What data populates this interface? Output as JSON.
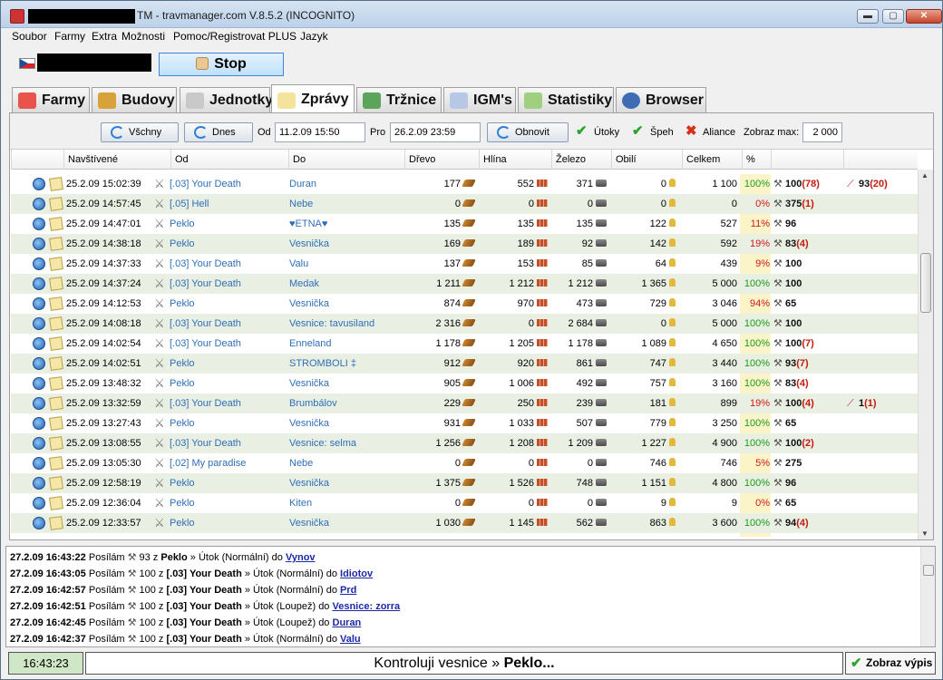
{
  "window": {
    "title": "TM - travmanager.com V.8.5.2 (INCOGNITO)",
    "buttons": {
      "minimize": "▬",
      "maximize": "▢",
      "close": "✕"
    }
  },
  "menu": [
    "Soubor",
    "Farmy",
    "Extra",
    "Možnosti",
    "Pomoc/Registrovat PLUS",
    "Jazyk"
  ],
  "toolbar": {
    "stop_label": "Stop"
  },
  "tabs": [
    {
      "label": "Farmy",
      "active": false
    },
    {
      "label": "Budovy",
      "active": false
    },
    {
      "label": "Jednotky",
      "active": false
    },
    {
      "label": "Zprávy",
      "active": true
    },
    {
      "label": "Tržnice",
      "active": false
    },
    {
      "label": "IGM's",
      "active": false
    },
    {
      "label": "Statistiky",
      "active": false
    },
    {
      "label": "Browser",
      "active": false
    }
  ],
  "filter": {
    "all_label": "Všchny",
    "today_label": "Dnes",
    "from_label": "Od",
    "from_value": "11.2.09 15:50",
    "to_label": "Pro",
    "to_value": "26.2.09 23:59",
    "refresh_label": "Obnovit",
    "attacks_label": "Útoky",
    "spy_label": "Špeh",
    "alliance_label": "Aliance",
    "show_max_label": "Zobraz max:",
    "show_max_value": "2 000"
  },
  "columns": [
    "Navštívené",
    "Od",
    "Do",
    "Dřevo",
    "Hlína",
    "Železo",
    "Obilí",
    "Celkem",
    "%"
  ],
  "reports": [
    {
      "time": "25.2.09 15:02:39",
      "from": "[.03] Your Death",
      "to": "Duran",
      "wood": "177",
      "clay": "552",
      "iron": "371",
      "crop": "0",
      "total": "1 100",
      "pct": "100%",
      "pct_color": "green",
      "troops": "100",
      "troops_lost": "(78)",
      "def": "93",
      "def_lost": "(20)"
    },
    {
      "time": "25.2.09 14:57:45",
      "from": "[.05] Hell",
      "to": "Nebe",
      "wood": "0",
      "clay": "0",
      "iron": "0",
      "crop": "0",
      "total": "0",
      "pct": "0%",
      "pct_color": "red",
      "troops": "375",
      "troops_lost": "(1)",
      "def": "",
      "def_lost": ""
    },
    {
      "time": "25.2.09 14:47:01",
      "from": "Peklo",
      "to": "♥ETNA♥",
      "wood": "135",
      "clay": "135",
      "iron": "135",
      "crop": "122",
      "total": "527",
      "pct": "11%",
      "pct_color": "red",
      "troops": "96",
      "troops_lost": "",
      "def": "",
      "def_lost": ""
    },
    {
      "time": "25.2.09 14:38:18",
      "from": "Peklo",
      "to": "Vesnička",
      "wood": "169",
      "clay": "189",
      "iron": "92",
      "crop": "142",
      "total": "592",
      "pct": "19%",
      "pct_color": "red",
      "troops": "83",
      "troops_lost": "(4)",
      "def": "",
      "def_lost": ""
    },
    {
      "time": "25.2.09 14:37:33",
      "from": "[.03] Your Death",
      "to": "Valu",
      "wood": "137",
      "clay": "153",
      "iron": "85",
      "crop": "64",
      "total": "439",
      "pct": "9%",
      "pct_color": "red",
      "troops": "100",
      "troops_lost": "",
      "def": "",
      "def_lost": ""
    },
    {
      "time": "25.2.09 14:37:24",
      "from": "[.03] Your Death",
      "to": "Medak",
      "wood": "1 211",
      "clay": "1 212",
      "iron": "1 212",
      "crop": "1 365",
      "total": "5 000",
      "pct": "100%",
      "pct_color": "green",
      "troops": "100",
      "troops_lost": "",
      "def": "",
      "def_lost": ""
    },
    {
      "time": "25.2.09 14:12:53",
      "from": "Peklo",
      "to": "Vesnička",
      "wood": "874",
      "clay": "970",
      "iron": "473",
      "crop": "729",
      "total": "3 046",
      "pct": "94%",
      "pct_color": "red",
      "troops": "65",
      "troops_lost": "",
      "def": "",
      "def_lost": ""
    },
    {
      "time": "25.2.09 14:08:18",
      "from": "[.03] Your Death",
      "to": "Vesnice: tavusiland",
      "wood": "2 316",
      "clay": "0",
      "iron": "2 684",
      "crop": "0",
      "total": "5 000",
      "pct": "100%",
      "pct_color": "green",
      "troops": "100",
      "troops_lost": "",
      "def": "",
      "def_lost": ""
    },
    {
      "time": "25.2.09 14:02:54",
      "from": "[.03] Your Death",
      "to": "Enneland",
      "wood": "1 178",
      "clay": "1 205",
      "iron": "1 178",
      "crop": "1 089",
      "total": "4 650",
      "pct": "100%",
      "pct_color": "green",
      "troops": "100",
      "troops_lost": "(7)",
      "def": "",
      "def_lost": ""
    },
    {
      "time": "25.2.09 14:02:51",
      "from": "Peklo",
      "to": "STROMBOLI ‡",
      "wood": "912",
      "clay": "920",
      "iron": "861",
      "crop": "747",
      "total": "3 440",
      "pct": "100%",
      "pct_color": "green",
      "troops": "93",
      "troops_lost": "(7)",
      "def": "",
      "def_lost": ""
    },
    {
      "time": "25.2.09 13:48:32",
      "from": "Peklo",
      "to": "Vesnička",
      "wood": "905",
      "clay": "1 006",
      "iron": "492",
      "crop": "757",
      "total": "3 160",
      "pct": "100%",
      "pct_color": "green",
      "troops": "83",
      "troops_lost": "(4)",
      "def": "",
      "def_lost": ""
    },
    {
      "time": "25.2.09 13:32:59",
      "from": "[.03] Your Death",
      "to": "Brumbálov",
      "wood": "229",
      "clay": "250",
      "iron": "239",
      "crop": "181",
      "total": "899",
      "pct": "19%",
      "pct_color": "red",
      "troops": "100",
      "troops_lost": "(4)",
      "def": "1",
      "def_lost": "(1)"
    },
    {
      "time": "25.2.09 13:27:43",
      "from": "Peklo",
      "to": "Vesnička",
      "wood": "931",
      "clay": "1 033",
      "iron": "507",
      "crop": "779",
      "total": "3 250",
      "pct": "100%",
      "pct_color": "green",
      "troops": "65",
      "troops_lost": "",
      "def": "",
      "def_lost": ""
    },
    {
      "time": "25.2.09 13:08:55",
      "from": "[.03] Your Death",
      "to": "Vesnice: selma",
      "wood": "1 256",
      "clay": "1 208",
      "iron": "1 209",
      "crop": "1 227",
      "total": "4 900",
      "pct": "100%",
      "pct_color": "green",
      "troops": "100",
      "troops_lost": "(2)",
      "def": "",
      "def_lost": ""
    },
    {
      "time": "25.2.09 13:05:30",
      "from": "[.02] My paradise",
      "to": "Nebe",
      "wood": "0",
      "clay": "0",
      "iron": "0",
      "crop": "746",
      "total": "746",
      "pct": "5%",
      "pct_color": "red",
      "troops": "275",
      "troops_lost": "",
      "def": "",
      "def_lost": ""
    },
    {
      "time": "25.2.09 12:58:19",
      "from": "Peklo",
      "to": "Vesnička",
      "wood": "1 375",
      "clay": "1 526",
      "iron": "748",
      "crop": "1 151",
      "total": "4 800",
      "pct": "100%",
      "pct_color": "green",
      "troops": "96",
      "troops_lost": "",
      "def": "",
      "def_lost": ""
    },
    {
      "time": "25.2.09 12:36:04",
      "from": "Peklo",
      "to": "Kiten",
      "wood": "0",
      "clay": "0",
      "iron": "0",
      "crop": "9",
      "total": "9",
      "pct": "0%",
      "pct_color": "red",
      "troops": "65",
      "troops_lost": "",
      "def": "",
      "def_lost": ""
    },
    {
      "time": "25.2.09 12:33:57",
      "from": "Peklo",
      "to": "Vesnička",
      "wood": "1 030",
      "clay": "1 145",
      "iron": "562",
      "crop": "863",
      "total": "3 600",
      "pct": "100%",
      "pct_color": "green",
      "troops": "94",
      "troops_lost": "(4)",
      "def": "",
      "def_lost": ""
    }
  ],
  "log": [
    {
      "time": "27.2.09 16:43:22",
      "pre": "Posílám",
      "count": "93",
      "z": "z",
      "from": "Peklo",
      "action": "» Útok (Normální) do",
      "target": "Vynov"
    },
    {
      "time": "27.2.09 16:43:05",
      "pre": "Posílám",
      "count": "100",
      "z": "z",
      "from": "[.03] Your Death",
      "action": "» Útok (Normální) do",
      "target": "Idiotov"
    },
    {
      "time": "27.2.09 16:42:57",
      "pre": "Posílám",
      "count": "100",
      "z": "z",
      "from": "[.03] Your Death",
      "action": "» Útok (Normální) do",
      "target": "Prd"
    },
    {
      "time": "27.2.09 16:42:51",
      "pre": "Posílám",
      "count": "100",
      "z": "z",
      "from": "[.03] Your Death",
      "action": "» Útok (Loupež) do",
      "target": "Vesnice: zorra"
    },
    {
      "time": "27.2.09 16:42:45",
      "pre": "Posílám",
      "count": "100",
      "z": "z",
      "from": "[.03] Your Death",
      "action": "» Útok (Loupež) do",
      "target": "Duran"
    },
    {
      "time": "27.2.09 16:42:37",
      "pre": "Posílám",
      "count": "100",
      "z": "z",
      "from": "[.03] Your Death",
      "action": "» Útok (Normální) do",
      "target": "Valu"
    }
  ],
  "status": {
    "clock": "16:43:23",
    "message_prefix": "Kontroluji vesnice » ",
    "message_village": "Peklo...",
    "show_log_label": "Zobraz výpis"
  },
  "colors": {
    "accent": "#2f6fb8",
    "green": "#1a9d1a",
    "red": "#d21818",
    "alt_row": "#e9efe2",
    "pct_bg": "#fbf4c8"
  }
}
